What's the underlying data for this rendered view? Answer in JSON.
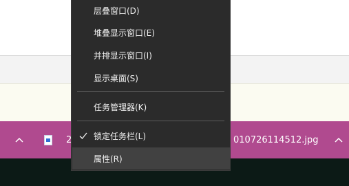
{
  "context_menu": {
    "items": [
      {
        "label": "层叠窗口(D)"
      },
      {
        "label": "堆叠显示窗口(E)"
      },
      {
        "label": "并排显示窗口(I)"
      },
      {
        "label": "显示桌面(S)"
      },
      {
        "label": "任务管理器(K)"
      },
      {
        "label": "锁定任务栏(L)",
        "checked": true
      },
      {
        "label": "属性(R)",
        "highlighted": true
      }
    ]
  },
  "download_bar": {
    "file_prefix": "2",
    "file_suffix": "010726114512.jpg",
    "file_icon": "image-file-icon",
    "left_caret_icon": "chevron-up-icon",
    "right_caret_icon": "chevron-up-icon"
  },
  "colors": {
    "menu_bg": "#2b2b2b",
    "menu_highlight": "#414141",
    "download_bar": "#b04a8f",
    "taskbar": "#0c1a16"
  }
}
